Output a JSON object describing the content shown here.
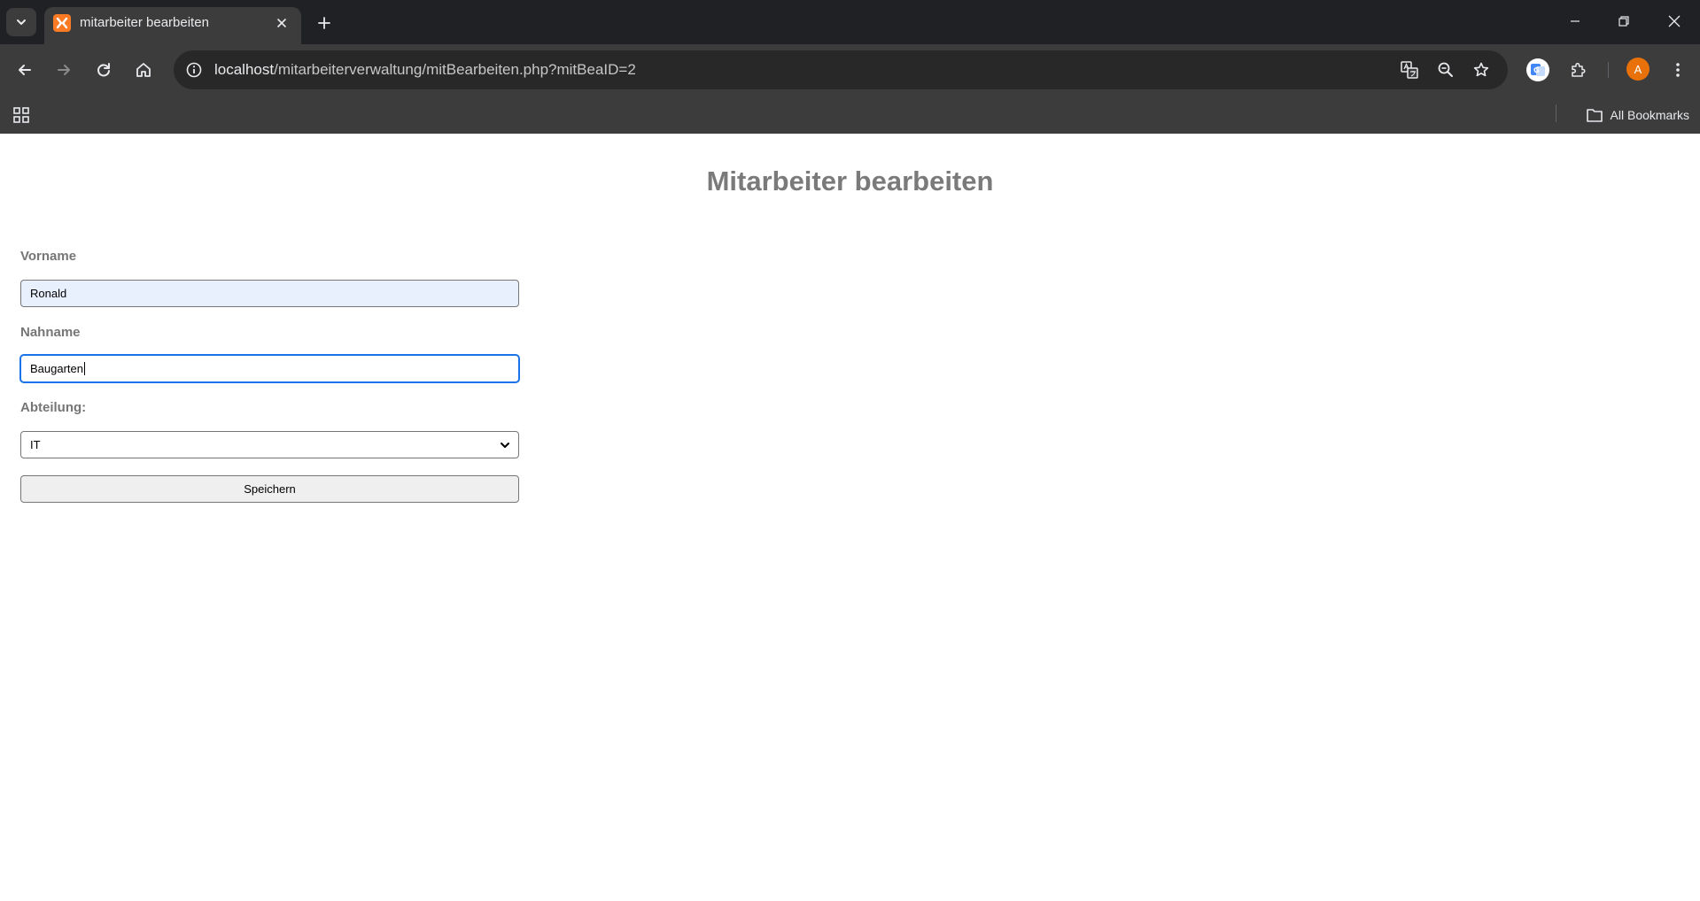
{
  "browser": {
    "tab": {
      "title": "mitarbeiter bearbeiten"
    },
    "address": {
      "host": "localhost",
      "path": "/mitarbeiterverwaltung/mitBearbeiten.php?mitBeaID=2"
    },
    "profile_initial": "A",
    "bookmarks_label": "All Bookmarks",
    "colors": {
      "favicon": "#fb7a24",
      "avatar": "#e8710a",
      "chrome_dark": "#202124",
      "chrome": "#3c3c3c"
    }
  },
  "page": {
    "title": "Mitarbeiter bearbeiten",
    "form": {
      "vorname": {
        "label": "Vorname",
        "value": "Ronald"
      },
      "nachname": {
        "label": "Nahname",
        "value": "Baugarten"
      },
      "abteilung": {
        "label": "Abteilung:",
        "selected": "IT"
      },
      "submit_label": "Speichern"
    }
  }
}
